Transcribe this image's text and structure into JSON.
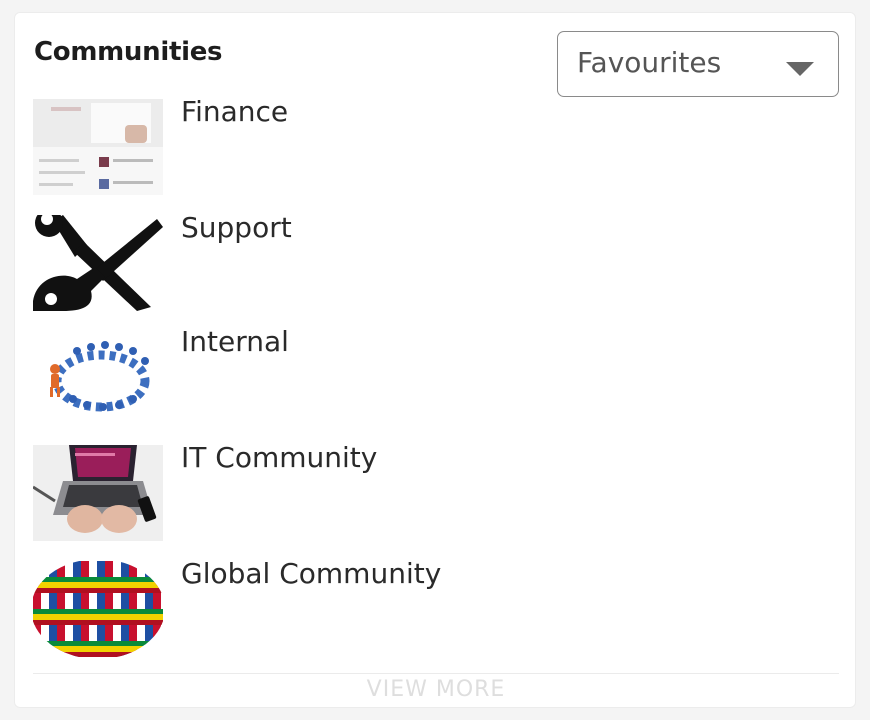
{
  "widget": {
    "title": "Communities",
    "filter": {
      "selected": "Favourites"
    },
    "items": [
      {
        "label": "Finance",
        "thumbnail": "finance-thumbnail"
      },
      {
        "label": "Support",
        "thumbnail": "tools-icon"
      },
      {
        "label": "Internal",
        "thumbnail": "people-circle-image"
      },
      {
        "label": "IT Community",
        "thumbnail": "laptop-image"
      },
      {
        "label": "Global Community",
        "thumbnail": "flags-globe-image"
      }
    ],
    "view_more_label": "VIEW MORE"
  },
  "colors": {
    "card_bg": "#ffffff",
    "text": "#222222",
    "muted": "#dedede"
  }
}
